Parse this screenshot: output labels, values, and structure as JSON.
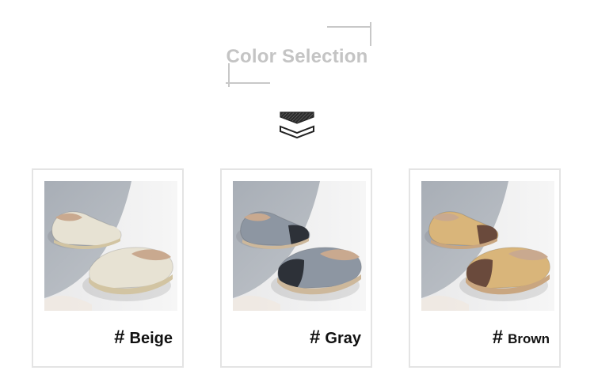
{
  "header": {
    "title": "Color Selection"
  },
  "colors": [
    {
      "hash": "#",
      "name": "Beige",
      "upper": "#e7e2d3",
      "toe": "#e7e2d3",
      "sole": "#d2c4a2",
      "lining": "#c9a98f"
    },
    {
      "hash": "#",
      "name": "Gray",
      "upper": "#8d96a2",
      "toe": "#2d3138",
      "sole": "#cdb89b",
      "lining": "#c9a98f"
    },
    {
      "hash": "#",
      "name": "Brown",
      "upper": "#d9b57a",
      "toe": "#6a4a3c",
      "sole": "#c9a680",
      "lining": "#c9a98f"
    }
  ],
  "icons": {
    "chevron": "double-chevron-down-icon"
  }
}
